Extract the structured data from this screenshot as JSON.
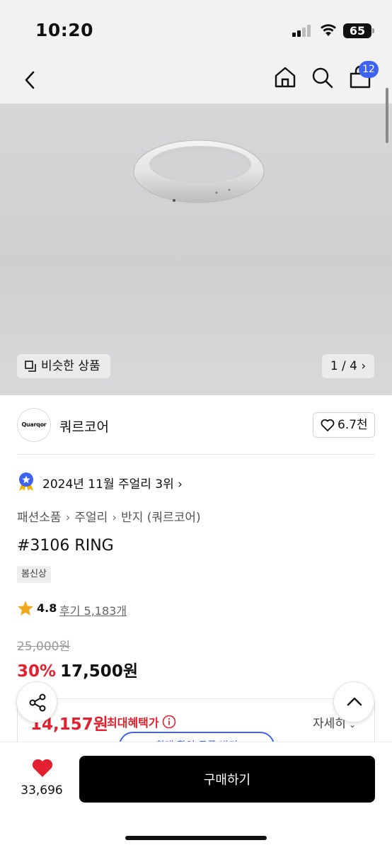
{
  "status_bar": {
    "time": "10:20",
    "battery": "65"
  },
  "nav": {
    "cart_count": "12"
  },
  "gallery": {
    "similar_label": "비슷한 상품",
    "page_indicator": "1 / 4 ›"
  },
  "store": {
    "logo_text": "Quarqor",
    "name": "쿼르코어",
    "likes": "6.7천"
  },
  "ranking": {
    "text": "2024년 11월 주얼리 3위 ›"
  },
  "breadcrumb": [
    "패션소품",
    "주얼리",
    "반지 (쿼르코어)"
  ],
  "product": {
    "title": "#3106 RING",
    "tag": "봄신상",
    "rating": "4.8",
    "reviews": "후기 5,183개",
    "original_price": "25,000원",
    "discount": "30%",
    "price": "17,500원"
  },
  "benefit": {
    "price": "14,157원",
    "label": "최대혜택가",
    "detail": "자세히",
    "coupon": "최대 할인 쿠폰 받기"
  },
  "bottom": {
    "wish_count": "33,696",
    "buy_label": "구매하기"
  },
  "colors": {
    "accent_red": "#e3202f",
    "accent_blue": "#3e63f0",
    "buy_button": "#000000"
  }
}
